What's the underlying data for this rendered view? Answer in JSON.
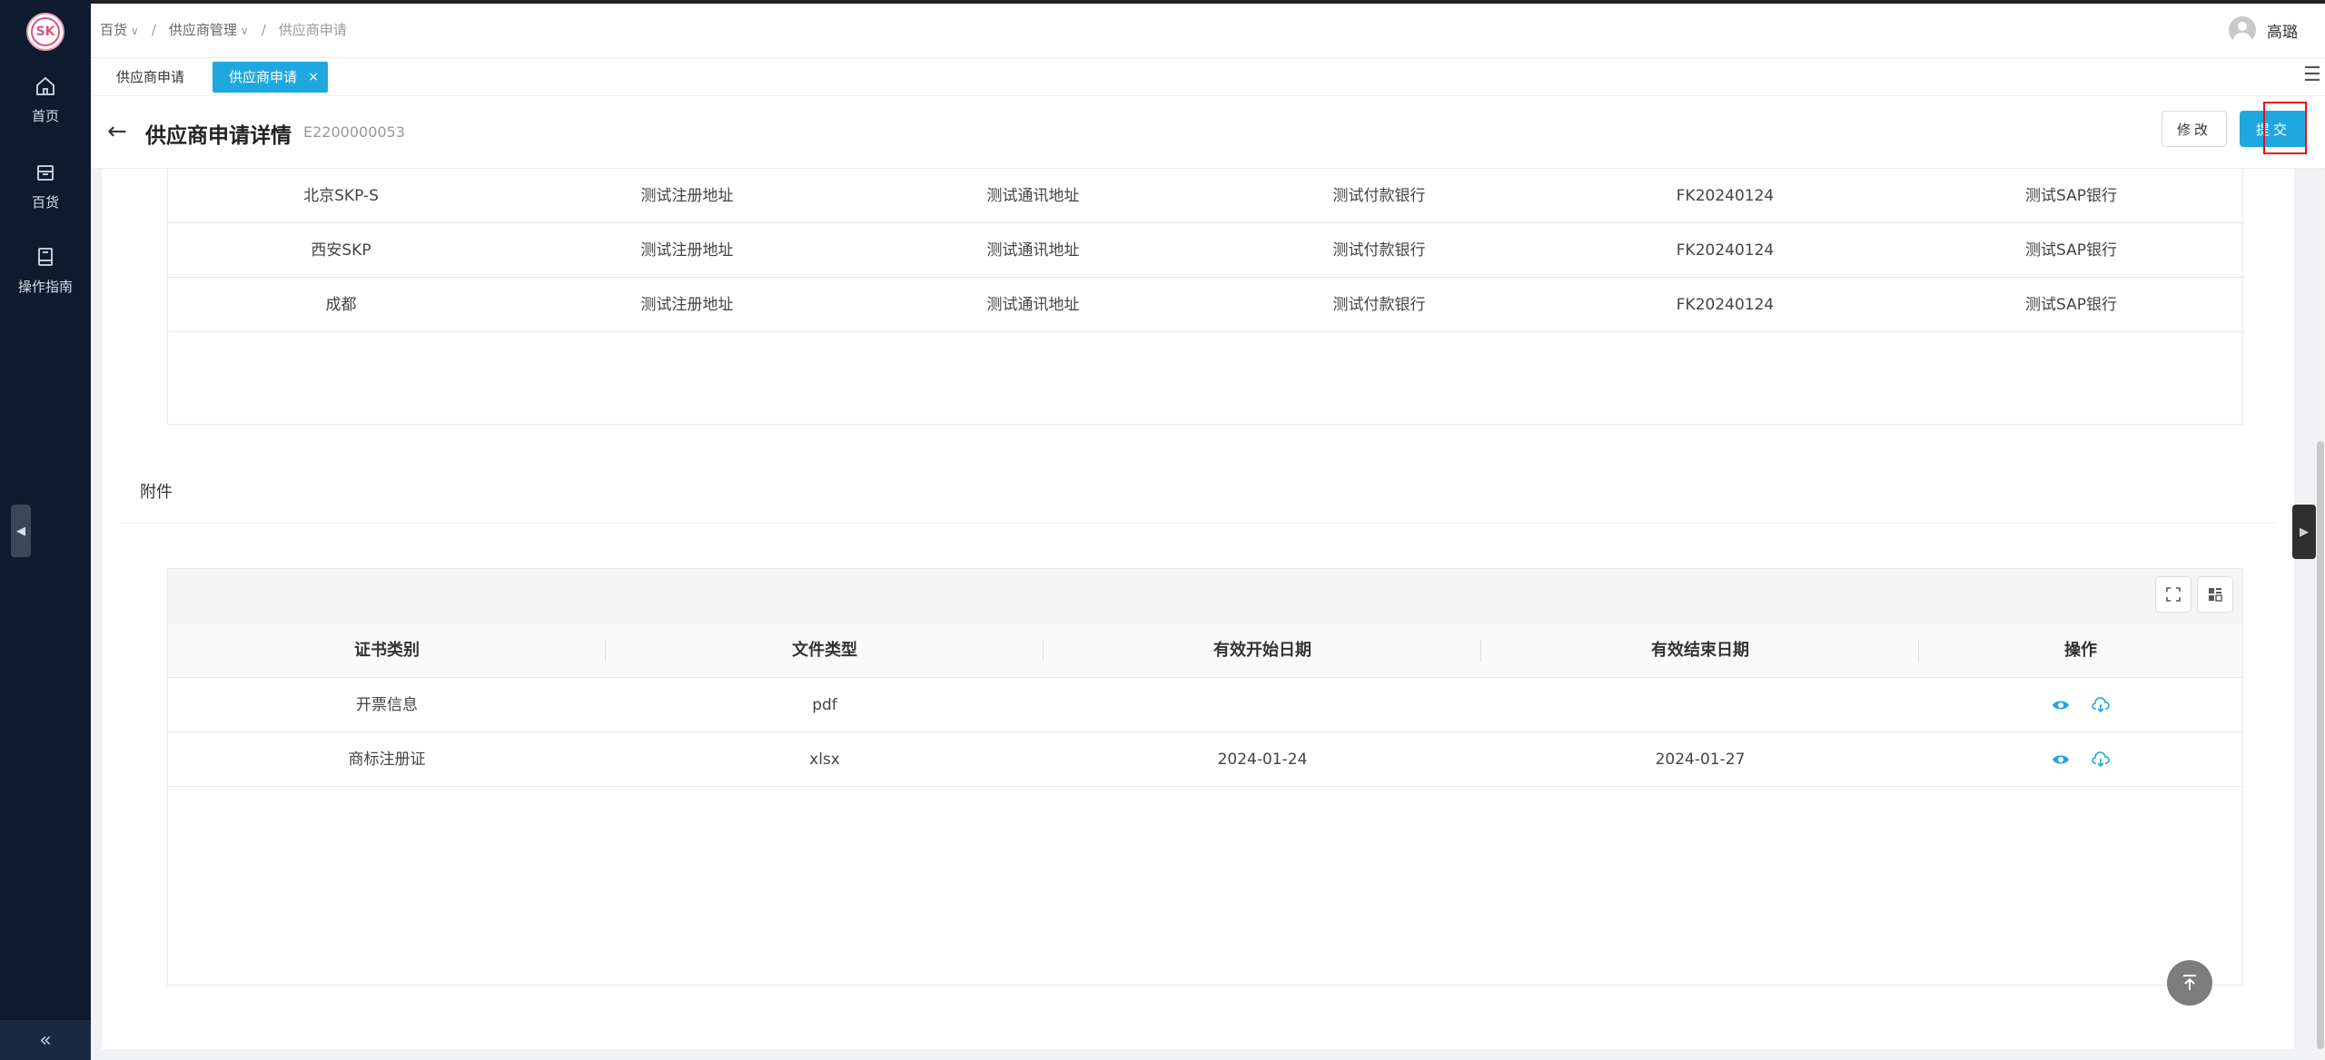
{
  "sidebar": {
    "items": [
      {
        "label": "首页",
        "icon": "home-icon"
      },
      {
        "label": "百货",
        "icon": "shop-icon"
      },
      {
        "label": "操作指南",
        "icon": "book-icon"
      }
    ],
    "collapse_glyph": "«"
  },
  "topbar": {
    "breadcrumb": [
      "百货",
      "供应商管理",
      "供应商申请"
    ],
    "user_name": "高璐"
  },
  "tabs": [
    {
      "label": "供应商申请"
    },
    {
      "label": "供应商申请",
      "active": true,
      "close": "×"
    }
  ],
  "header": {
    "title": "供应商申请详情",
    "code": "E2200000053",
    "edit_label": "修改",
    "submit_label": "提交"
  },
  "bank_table": {
    "rows": [
      [
        "北京SKP-S",
        "测试注册地址",
        "测试通讯地址",
        "测试付款银行",
        "FK20240124",
        "测试SAP银行"
      ],
      [
        "西安SKP",
        "测试注册地址",
        "测试通讯地址",
        "测试付款银行",
        "FK20240124",
        "测试SAP银行"
      ],
      [
        "成都",
        "测试注册地址",
        "测试通讯地址",
        "测试付款银行",
        "FK20240124",
        "测试SAP银行"
      ]
    ]
  },
  "attachments": {
    "section_title": "附件",
    "columns": [
      "证书类别",
      "文件类型",
      "有效开始日期",
      "有效结束日期",
      "操作"
    ],
    "rows": [
      [
        "开票信息",
        "pdf",
        "",
        ""
      ],
      [
        "商标注册证",
        "xlsx",
        "2024-01-24",
        "2024-01-27"
      ]
    ]
  },
  "colors": {
    "accent": "#1fa8e0",
    "sidebar_bg": "#0f1a2e",
    "highlight": "#ee1111"
  }
}
